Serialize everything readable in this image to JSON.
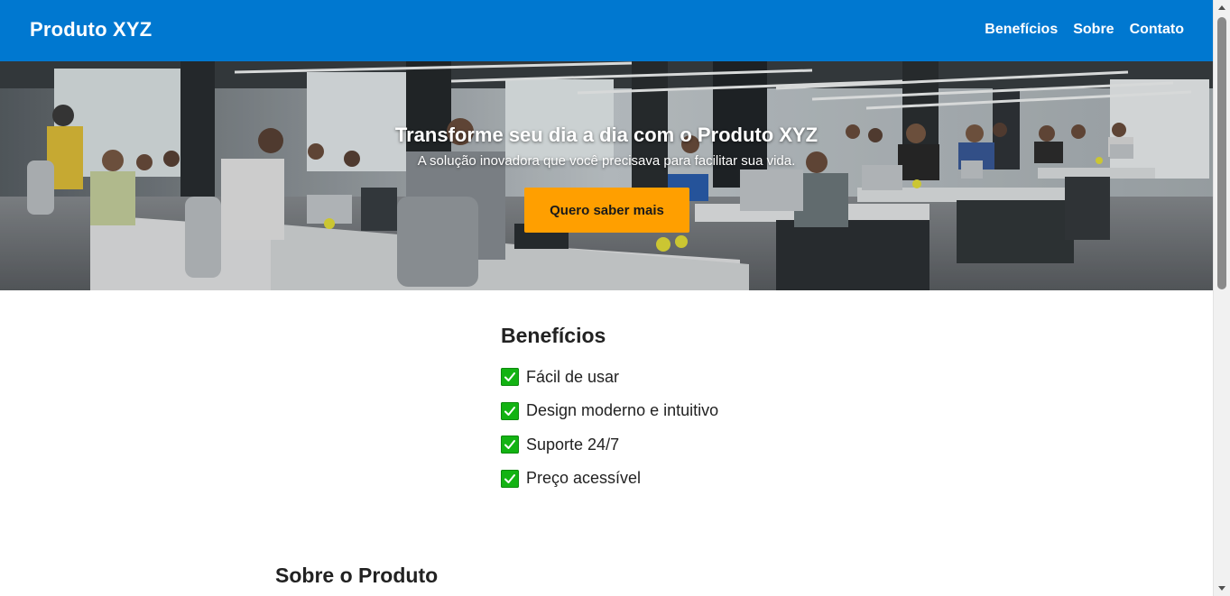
{
  "header": {
    "brand": "Produto XYZ",
    "nav": [
      "Benefícios",
      "Sobre",
      "Contato"
    ],
    "background_color": "#0078d0"
  },
  "hero": {
    "title": "Transforme seu dia a dia com o Produto XYZ",
    "subtitle": "A solução inovadora que você precisava para facilitar sua vida.",
    "cta_label": "Quero saber mais",
    "cta_color": "#ff9f00"
  },
  "benefits": {
    "title": "Benefícios",
    "items": [
      "Fácil de usar",
      "Design moderno e intuitivo",
      "Suporte 24/7",
      "Preço acessível"
    ],
    "check_icon": "check-mark-icon"
  },
  "about": {
    "title": "Sobre o Produto"
  }
}
